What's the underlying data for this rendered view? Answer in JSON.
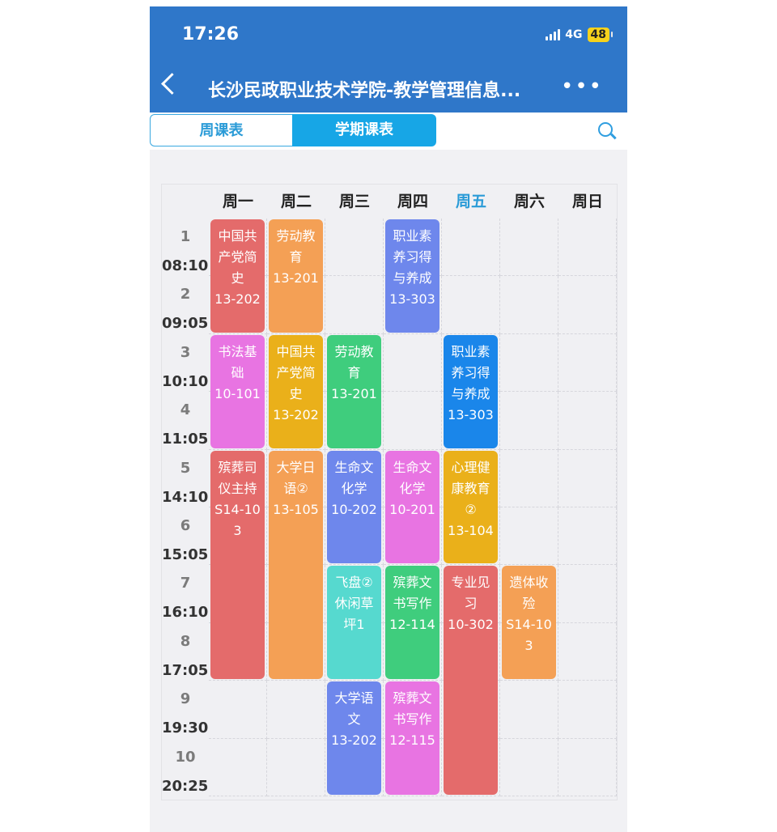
{
  "status": {
    "time": "17:26",
    "network": "4G",
    "battery": "48"
  },
  "header": {
    "title": "长沙民政职业技术学院-教学管理信息..."
  },
  "tabs": [
    {
      "label": "周课表"
    },
    {
      "label": "学期课表"
    }
  ],
  "days": [
    "周一",
    "周二",
    "周三",
    "周四",
    "周五",
    "周六",
    "周日"
  ],
  "today_index": 4,
  "periods": [
    {
      "num": "1",
      "time": "08:10"
    },
    {
      "num": "2",
      "time": "09:05"
    },
    {
      "num": "3",
      "time": "10:10"
    },
    {
      "num": "4",
      "time": "11:05"
    },
    {
      "num": "5",
      "time": "14:10"
    },
    {
      "num": "6",
      "time": "15:05"
    },
    {
      "num": "7",
      "time": "16:10"
    },
    {
      "num": "8",
      "time": "17:05"
    },
    {
      "num": "9",
      "time": "19:30"
    },
    {
      "num": "10",
      "time": "20:25"
    }
  ],
  "courses": [
    {
      "day": 0,
      "start": 1,
      "span": 2,
      "lines": [
        "中国共",
        "产党简",
        "史",
        "13-202"
      ],
      "color": "#e46b6b"
    },
    {
      "day": 0,
      "start": 3,
      "span": 2,
      "lines": [
        "书法基",
        "础",
        "10-101"
      ],
      "color": "#e874e2"
    },
    {
      "day": 0,
      "start": 5,
      "span": 4,
      "lines": [
        "殡葬司",
        "仪主持",
        "S14-10",
        "3"
      ],
      "color": "#e46b6b"
    },
    {
      "day": 1,
      "start": 1,
      "span": 2,
      "lines": [
        "劳动教",
        "育",
        "13-201"
      ],
      "color": "#f4a055"
    },
    {
      "day": 1,
      "start": 3,
      "span": 2,
      "lines": [
        "中国共",
        "产党简",
        "史",
        "13-202"
      ],
      "color": "#eab01a"
    },
    {
      "day": 1,
      "start": 5,
      "span": 4,
      "lines": [
        "大学日",
        "语②",
        "13-105"
      ],
      "color": "#f4a055"
    },
    {
      "day": 2,
      "start": 3,
      "span": 2,
      "lines": [
        "劳动教",
        "育",
        "13-201"
      ],
      "color": "#3fcd7d"
    },
    {
      "day": 2,
      "start": 5,
      "span": 2,
      "lines": [
        "生命文",
        "化学",
        "10-202"
      ],
      "color": "#6e87ec"
    },
    {
      "day": 2,
      "start": 7,
      "span": 2,
      "lines": [
        "飞盘②",
        "休闲草",
        "坪1"
      ],
      "color": "#56d9cf"
    },
    {
      "day": 2,
      "start": 9,
      "span": 2,
      "lines": [
        "大学语",
        "文",
        "13-202"
      ],
      "color": "#6e87ec"
    },
    {
      "day": 3,
      "start": 1,
      "span": 2,
      "lines": [
        "职业素",
        "养习得",
        "与养成",
        "13-303"
      ],
      "color": "#6e87ec"
    },
    {
      "day": 3,
      "start": 5,
      "span": 2,
      "lines": [
        "生命文",
        "化学",
        "10-201"
      ],
      "color": "#e874e2"
    },
    {
      "day": 3,
      "start": 7,
      "span": 2,
      "lines": [
        "殡葬文",
        "书写作",
        "12-114"
      ],
      "color": "#3fcd7d"
    },
    {
      "day": 3,
      "start": 9,
      "span": 2,
      "lines": [
        "殡葬文",
        "书写作",
        "12-115"
      ],
      "color": "#e874e2"
    },
    {
      "day": 4,
      "start": 3,
      "span": 2,
      "lines": [
        "职业素",
        "养习得",
        "与养成",
        "13-303"
      ],
      "color": "#1a86ea"
    },
    {
      "day": 4,
      "start": 5,
      "span": 2,
      "lines": [
        "心理健",
        "康教育",
        "②",
        "13-104"
      ],
      "color": "#eab01a"
    },
    {
      "day": 4,
      "start": 7,
      "span": 4,
      "lines": [
        "专业见",
        "习",
        "10-302"
      ],
      "color": "#e46b6b"
    },
    {
      "day": 5,
      "start": 7,
      "span": 2,
      "lines": [
        "遗体收",
        "殓",
        "S14-10",
        "3"
      ],
      "color": "#f4a055"
    }
  ]
}
